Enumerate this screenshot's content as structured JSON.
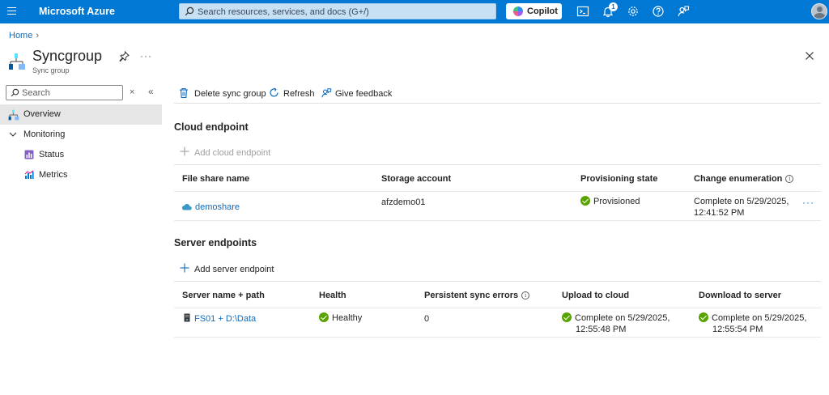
{
  "topbar": {
    "brand": "Microsoft Azure",
    "search_placeholder": "Search resources, services, and docs (G+/)",
    "copilot_label": "Copilot",
    "notification_count": "1",
    "bar_color": "#0078d4"
  },
  "header": {
    "breadcrumb": "Home",
    "title": "Syncgroup",
    "subtitle": "Sync group"
  },
  "nav": {
    "search_placeholder": "Search",
    "items": [
      {
        "label": "Overview",
        "icon": "syncgroup-icon",
        "active": true
      },
      {
        "label": "Monitoring",
        "icon": "chevron-down-icon",
        "expanded": true
      },
      {
        "label": "Status",
        "icon": "status-icon"
      },
      {
        "label": "Metrics",
        "icon": "metrics-icon"
      }
    ]
  },
  "commands": {
    "delete": "Delete sync group",
    "refresh": "Refresh",
    "feedback": "Give feedback"
  },
  "cloud": {
    "title": "Cloud endpoint",
    "add_label": "Add cloud endpoint",
    "columns": [
      "File share name",
      "Storage account",
      "Provisioning state",
      "Change enumeration"
    ],
    "rows": [
      {
        "file_share": "demoshare",
        "storage_account": "afzdemo01",
        "provisioning_state": "Provisioned",
        "change_enum_line1": "Complete on 5/29/2025,",
        "change_enum_line2": "12:41:52 PM"
      }
    ]
  },
  "server": {
    "title": "Server endpoints",
    "add_label": "Add server endpoint",
    "columns": [
      "Server name + path",
      "Health",
      "Persistent sync errors",
      "Upload to cloud",
      "Download to server"
    ],
    "rows": [
      {
        "server_path": "FS01 + D:\\Data",
        "health": "Healthy",
        "sync_errors": "0",
        "upload_line1": "Complete on 5/29/2025,",
        "upload_line2": "12:55:48 PM",
        "download_line1": "Complete on 5/29/2025,",
        "download_line2": "12:55:54 PM"
      }
    ]
  },
  "colors": {
    "link": "#0f6cbd",
    "success": "#57a300"
  }
}
